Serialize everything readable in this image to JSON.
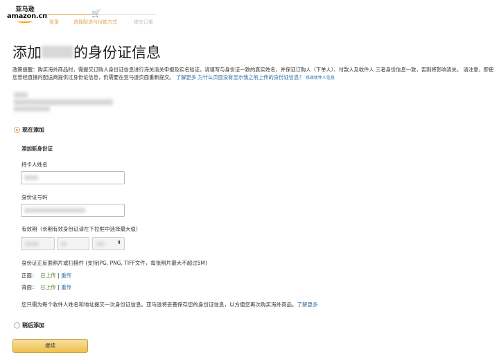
{
  "header": {
    "logo_cn": "亚马逊",
    "logo_en": "amazon.cn",
    "steps": [
      "登录",
      "选择配送与付款方式",
      "提交订单"
    ]
  },
  "title": {
    "prefix": "添加",
    "suffix": "的身份证信息"
  },
  "policy": {
    "text": "政策提醒：购买海外商品时，需提交订购人身份证信息进行海关清关申报及实名验证。请填写与身份证一致的真实姓名，并保证订购人（下单人）、付款人及收件人 三者身份信息一致，否则将影响清关。 请注意，即使您曾经直接向配送商提供过身份证信息，仍需要在亚马逊页面重新提交。",
    "learn_more": "了解更多",
    "why_link": "为什么页面没有显示我之前上传的身份证信息？",
    "edit_recipient": "修改收件人信息"
  },
  "form": {
    "add_now": "现在添加",
    "section_title": "添加新身份证",
    "name_label": "持卡人姓名",
    "id_label": "身份证号码",
    "validity_label": "有效期（长期有效身份证请在下拉框中选择最大值）",
    "upload_label": "身份证正反面照片或扫描件 (支持JPG, PNG, TIFF文件，每张照片最大不超过5M)",
    "front_label": "正面：",
    "back_label": "背面：",
    "uploaded": "已上传",
    "separator": "|",
    "reupload": "重传",
    "note": "您只需为每个收件人姓名和地址提交一次身份证信息。亚马逊将妥善保存您的身份证信息，以方便您再次购买海外商品。",
    "note_link": "了解更多",
    "add_later": "稍后添加",
    "continue": "继续"
  },
  "colors": {
    "accent": "#e2a35a",
    "link": "#2a6fa8",
    "button": "#f0c14b"
  }
}
